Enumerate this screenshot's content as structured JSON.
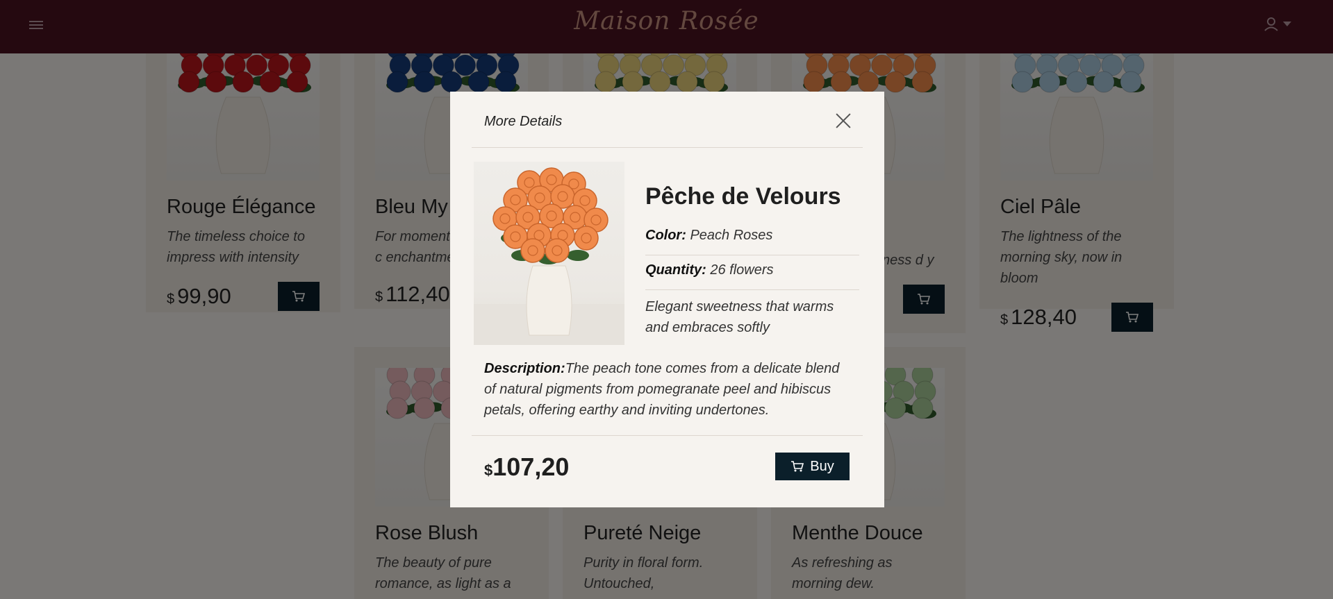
{
  "header": {
    "brand": "Maison Rosée",
    "brand_color": "#c6917f",
    "bg_color": "#4a1220",
    "menu_icon": "hamburger-icon",
    "user_icon": "user-icon"
  },
  "products": [
    {
      "name": "Rouge Élégance",
      "desc": "The timeless choice to impress with intensity",
      "currency": "$",
      "price": "99,90",
      "rose_color": "#b8141a"
    },
    {
      "name": "Bleu My",
      "desc": "For moment for silence, c enchantmen",
      "currency": "$",
      "price": "112,40",
      "rose_color": "#143a78"
    },
    {
      "name": "",
      "desc": "",
      "currency": "",
      "price": "",
      "rose_color": "#e9d07a"
    },
    {
      "name": "",
      "desc": "ness d y",
      "currency": "",
      "price": "",
      "rose_color": "#f08a4b"
    },
    {
      "name": "Ciel Pâle",
      "desc": "The lightness of the morning sky, now in bloom",
      "currency": "$",
      "price": "128,40",
      "rose_color": "#a8c8dc"
    },
    {
      "name": "Rose Blush",
      "desc": "The beauty of pure romance, as light as a",
      "currency": "",
      "price": "",
      "rose_color": "#eab7bb"
    },
    {
      "name": "Pureté Neige",
      "desc": "Purity in floral form. Untouched,",
      "currency": "",
      "price": "",
      "rose_color": "#f6f3ef"
    },
    {
      "name": "Menthe Douce",
      "desc": "As refreshing as morning dew.",
      "currency": "",
      "price": "",
      "rose_color": "#a9cc98"
    }
  ],
  "modal": {
    "title": "More Details",
    "product_name": "Pêche de Velours",
    "color_label": "Color:",
    "color_value": "Peach Roses",
    "quantity_label": "Quantity:",
    "quantity_value": "26 flowers",
    "tagline": "Elegant sweetness that warms and embraces softly",
    "description_label": "Description:",
    "description": "The peach tone comes from a delicate blend of natural pigments from pomegranate peel and hibiscus petals, offering earthy and inviting undertones.",
    "currency": "$",
    "price": "107,20",
    "buy_label": "Buy",
    "rose_color": "#f08a4b"
  }
}
